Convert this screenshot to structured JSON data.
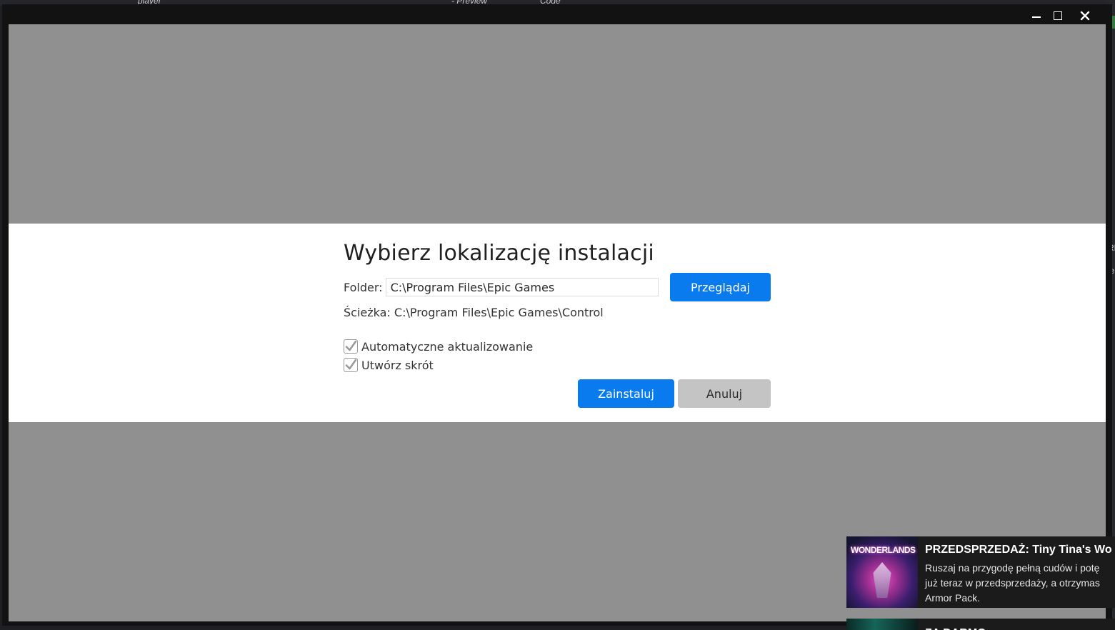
{
  "background": {
    "fragments": [
      "player",
      "- Preview",
      "Code"
    ],
    "right_fragments": [
      "RL",
      "ie"
    ]
  },
  "window": {
    "controls": {
      "minimize": "minimize-icon",
      "maximize": "maximize-icon",
      "close": "close-icon"
    }
  },
  "dialog": {
    "title": "Wybierz lokalizację instalacji",
    "folder_label": "Folder:",
    "folder_value": "C:\\Program Files\\Epic Games",
    "browse_label": "Przeglądaj",
    "path_text": "Ścieżka: C:\\Program Files\\Epic Games\\Control",
    "options": [
      {
        "label": "Automatyczne aktualizowanie",
        "checked": true
      },
      {
        "label": "Utwórz skrót",
        "checked": true
      }
    ],
    "install_label": "Zainstaluj",
    "cancel_label": "Anuluj"
  },
  "notifications": [
    {
      "thumb_text": "WONDERLANDS",
      "title": "PRZEDSPRZEDAŻ: Tiny Tina's Wo",
      "lines": [
        "Ruszaj na przygodę pełną cudów i potę",
        "już teraz w przedsprzedaży, a otrzymas",
        "Armor Pack."
      ]
    },
    {
      "title": "ZA DARMO: ..."
    }
  ],
  "colors": {
    "accent": "#0a7aef",
    "overlay": "#909090",
    "cancel": "#c4c4c4",
    "window_chrome": "#121212"
  }
}
